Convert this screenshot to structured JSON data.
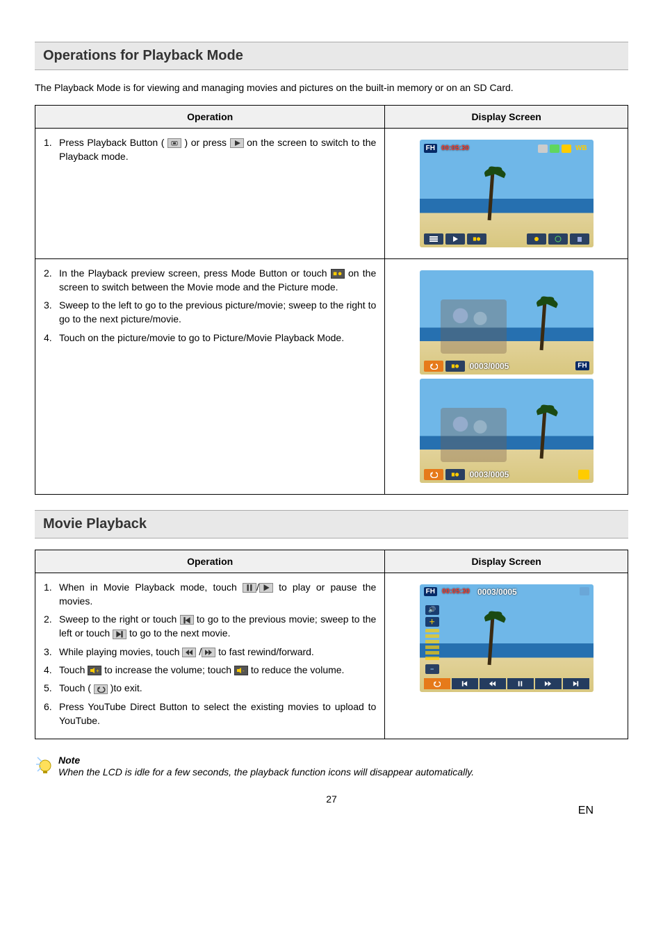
{
  "sections": {
    "playback": {
      "title": "Operations for Playback Mode",
      "intro": "The Playback Mode is for viewing and managing movies and pictures on the built-in memory or on an SD Card.",
      "headers": {
        "op": "Operation",
        "disp": "Display Screen"
      },
      "row1": {
        "n1": "1.",
        "t1a": "Press Playback Button ( ",
        "t1b": " ) or press ",
        "t1c": " on the screen to switch to the Playback mode."
      },
      "row2": {
        "n2": "2.",
        "t2a": "In the Playback preview screen, press Mode Button or touch ",
        "t2b": " on the screen to switch between the Movie mode and the Picture mode.",
        "n3": "3.",
        "t3": "Sweep to the left to go to the previous picture/movie; sweep to the right to go to the next picture/movie.",
        "n4": "4.",
        "t4": "Touch on the picture/movie to go to Picture/Movie Playback Mode."
      },
      "screen1": {
        "rec_time": "00:05:30"
      },
      "screen2": {
        "counter": "0003/0005"
      },
      "screen3": {
        "counter": "0003/0005"
      }
    },
    "movie": {
      "title": "Movie Playback",
      "headers": {
        "op": "Operation",
        "disp": "Display Screen"
      },
      "items": {
        "n1": "1.",
        "t1a": "When in Movie Playback mode, touch ",
        "t1b": " to play or pause the movies.",
        "n2": "2.",
        "t2a": "Sweep to the right or touch ",
        "t2b": " to go to the previous movie; sweep to the left or touch ",
        "t2c": " to go to the next movie.",
        "n3": "3.",
        "t3a": "While playing movies, touch ",
        "t3b": "to fast rewind/forward.",
        "n4": "4.",
        "t4a": "Touch ",
        "t4b": "to increase the volume; touch ",
        "t4c": " to reduce the volume.",
        "n5": "5.",
        "t5a": "Touch ( ",
        "t5b": " )to exit.",
        "n6": "6.",
        "t6": "Press YouTube Direct Button to select the existing movies to upload to YouTube."
      },
      "screen": {
        "time": "00:05:30",
        "counter": "0003/0005"
      },
      "note": {
        "title": "Note",
        "body": "When the LCD is idle for a few seconds, the playback function icons will disappear automatically."
      }
    }
  },
  "osd": {
    "fh": "FH",
    "wb": "WB"
  },
  "footer": {
    "page": "27",
    "lang": "EN"
  }
}
